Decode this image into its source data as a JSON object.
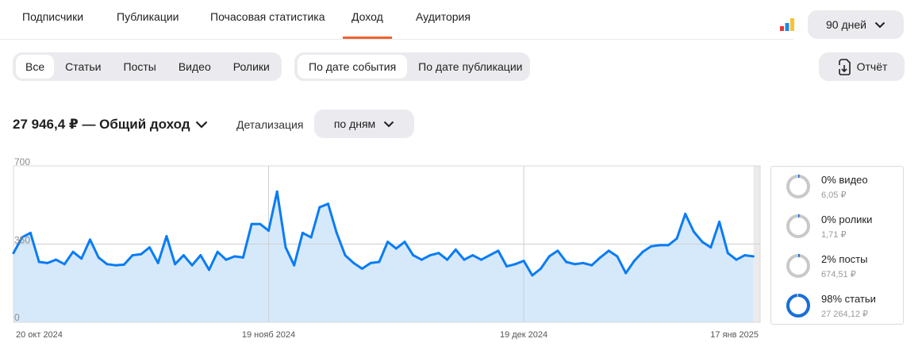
{
  "tabs": [
    {
      "label": "Подписчики",
      "active": false
    },
    {
      "label": "Публикации",
      "active": false
    },
    {
      "label": "Почасовая статистика",
      "active": false
    },
    {
      "label": "Доход",
      "active": true
    },
    {
      "label": "Аудитория",
      "active": false
    }
  ],
  "period": {
    "label": "90 дней",
    "icon": "chevron-down-icon"
  },
  "bars_icon_colors": [
    "#e53935",
    "#1e88e5",
    "#fbc02d"
  ],
  "content_filter": [
    {
      "label": "Все",
      "active": true
    },
    {
      "label": "Статьи",
      "active": false
    },
    {
      "label": "Посты",
      "active": false
    },
    {
      "label": "Видео",
      "active": false
    },
    {
      "label": "Ролики",
      "active": false
    }
  ],
  "date_filter": [
    {
      "label": "По дате события",
      "active": true
    },
    {
      "label": "По дате публикации",
      "active": false
    }
  ],
  "report": {
    "label": "Отчёт",
    "icon": "report-download-icon"
  },
  "summary": {
    "title": "27 946,4 ₽ — Общий доход"
  },
  "detail": {
    "label": "Детализация",
    "value": "по дням"
  },
  "colors": {
    "accent": "#f2622e",
    "line": "#0a7cf5",
    "fill": "#d6e9fb",
    "ring_track": "#c9c9c9",
    "ring_value": "#1a6fd8"
  },
  "chart_data": {
    "type": "area",
    "y_ticks": [
      "700",
      "350",
      "0"
    ],
    "ylim": [
      0,
      700
    ],
    "x_tick_labels": [
      {
        "label": "20 окт 2024",
        "index": 0
      },
      {
        "label": "19 нояб 2024",
        "index": 30
      },
      {
        "label": "19 дек 2024",
        "index": 60
      },
      {
        "label": "17 янв 2025",
        "index": 89
      }
    ],
    "vertical_lines": [
      30,
      60
    ],
    "partial_last_day": true,
    "values": [
      310,
      380,
      400,
      270,
      265,
      280,
      260,
      315,
      285,
      370,
      290,
      260,
      255,
      258,
      300,
      305,
      335,
      265,
      385,
      260,
      300,
      255,
      300,
      235,
      315,
      280,
      295,
      290,
      440,
      440,
      410,
      585,
      335,
      255,
      400,
      380,
      515,
      530,
      400,
      300,
      265,
      240,
      265,
      270,
      360,
      330,
      360,
      300,
      280,
      300,
      310,
      280,
      325,
      280,
      300,
      280,
      300,
      320,
      250,
      260,
      275,
      210,
      240,
      295,
      320,
      270,
      260,
      265,
      255,
      290,
      320,
      295,
      220,
      275,
      315,
      340,
      345,
      345,
      375,
      485,
      405,
      360,
      335,
      450,
      310,
      280,
      300,
      295
    ]
  },
  "breakdown": [
    {
      "pct": "0% видео",
      "amount": "6,05 ₽",
      "fraction": 0.0002
    },
    {
      "pct": "0% ролики",
      "amount": "1,71 ₽",
      "fraction": 0.0001
    },
    {
      "pct": "2% посты",
      "amount": "674,51 ₽",
      "fraction": 0.024
    },
    {
      "pct": "98% статьи",
      "amount": "27 264,12 ₽",
      "fraction": 0.976
    }
  ]
}
